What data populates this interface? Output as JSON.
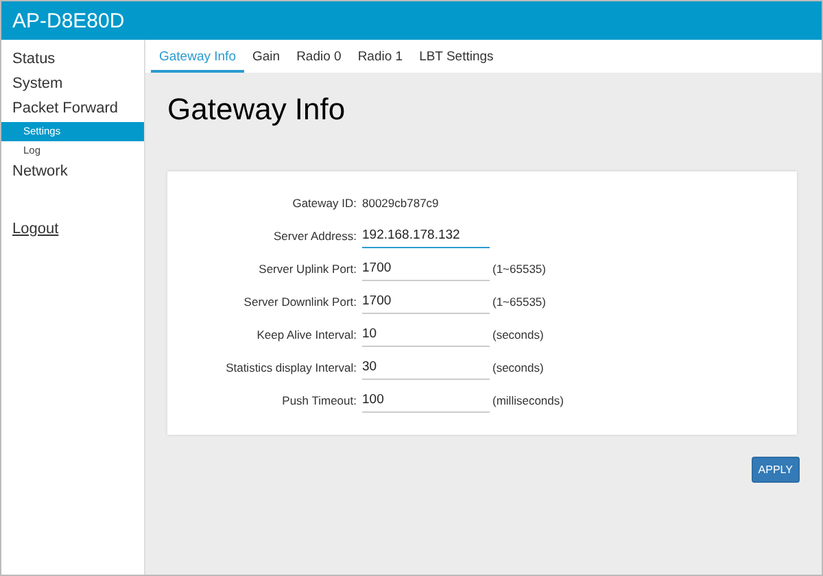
{
  "header": {
    "title": "AP-D8E80D"
  },
  "sidebar": {
    "items": [
      {
        "label": "Status",
        "selected": false
      },
      {
        "label": "System",
        "selected": false
      },
      {
        "label": "Packet Forward",
        "selected": false,
        "children": [
          {
            "label": "Settings",
            "selected": true
          },
          {
            "label": "Log",
            "selected": false
          }
        ]
      },
      {
        "label": "Network",
        "selected": false
      }
    ],
    "logout": "Logout"
  },
  "tabs": [
    {
      "label": "Gateway Info",
      "selected": true
    },
    {
      "label": "Gain",
      "selected": false
    },
    {
      "label": "Radio 0",
      "selected": false
    },
    {
      "label": "Radio 1",
      "selected": false
    },
    {
      "label": "LBT Settings",
      "selected": false
    }
  ],
  "heading": "Gateway Info",
  "fields": [
    {
      "kind": "text",
      "label": "Gateway ID:",
      "value": "80029cb787c9"
    },
    {
      "kind": "input",
      "label": "Server Address:",
      "value": "192.168.178.132",
      "focused": true
    },
    {
      "kind": "input",
      "label": "Server Uplink Port:",
      "value": "1700",
      "focused": false,
      "unit": "(1~65535)"
    },
    {
      "kind": "input",
      "label": "Server Downlink Port:",
      "value": "1700",
      "focused": false,
      "unit": "(1~65535)"
    },
    {
      "kind": "input",
      "label": "Keep Alive Interval:",
      "value": "10",
      "focused": false,
      "unit": "(seconds)"
    },
    {
      "kind": "input",
      "label": "Statistics display Interval:",
      "value": "30",
      "focused": false,
      "unit": "(seconds)"
    },
    {
      "kind": "input",
      "label": "Push Timeout:",
      "value": "100",
      "focused": false,
      "unit": "(milliseconds)"
    }
  ],
  "apply_button": "APPLY"
}
